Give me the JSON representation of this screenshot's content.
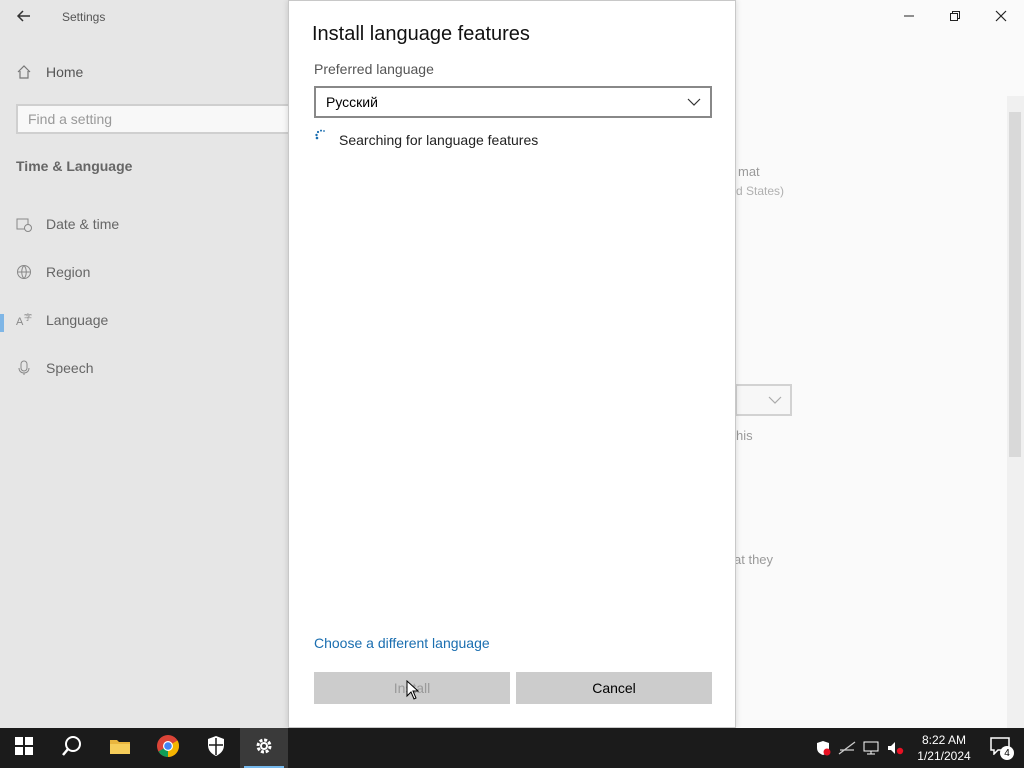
{
  "settings": {
    "window_title": "Settings",
    "home_label": "Home",
    "search_placeholder": "Find a setting",
    "section_title": "Time & Language",
    "nav_items": [
      {
        "label": "Date & time",
        "icon": "calendar-clock-icon"
      },
      {
        "label": "Region",
        "icon": "globe-icon"
      },
      {
        "label": "Language",
        "icon": "language-icon",
        "active": true
      },
      {
        "label": "Speech",
        "icon": "microphone-icon"
      }
    ],
    "background_fragments": {
      "format": "mat",
      "format_sub": "d States)",
      "this": "his",
      "that_they": "at they"
    }
  },
  "dialog": {
    "title": "Install language features",
    "preferred_language_label": "Preferred language",
    "selected_language": "Русский",
    "status_text": "Searching for language features",
    "choose_link": "Choose a different language",
    "install_label": "Install",
    "cancel_label": "Cancel"
  },
  "taskbar": {
    "time": "8:22 AM",
    "date": "1/21/2024",
    "notification_count": "4"
  },
  "colors": {
    "accent": "#76b9ed",
    "link": "#1a6eb0",
    "taskbar": "#1b1b1b"
  }
}
